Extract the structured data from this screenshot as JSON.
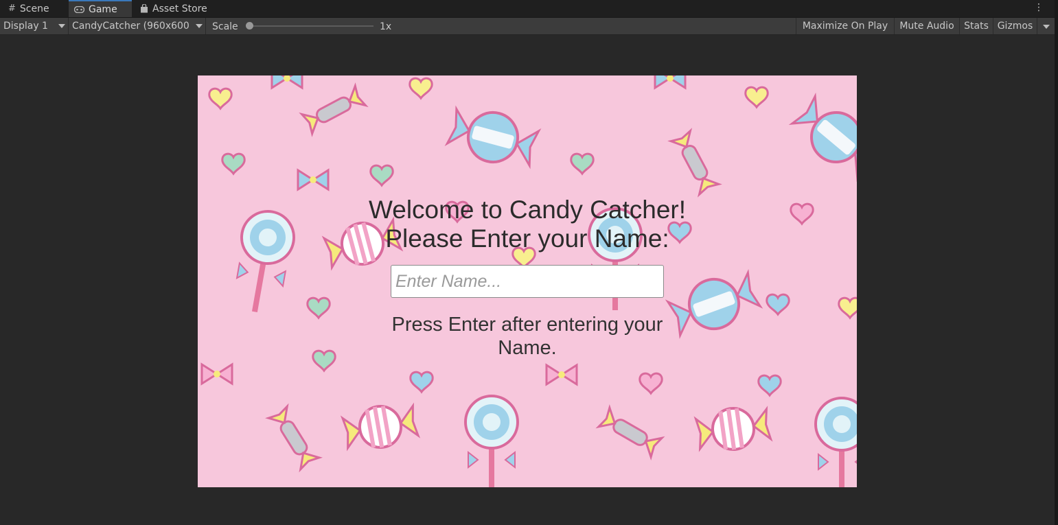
{
  "tabs": [
    {
      "label": "Scene",
      "icon": "grid-icon"
    },
    {
      "label": "Game",
      "icon": "gamepad-icon"
    },
    {
      "label": "Asset Store",
      "icon": "bag-icon"
    }
  ],
  "toolbar": {
    "display": "Display 1",
    "resolution": "CandyCatcher (960x600",
    "scale_label": "Scale",
    "scale_value": "1x",
    "maximize": "Maximize On Play",
    "mute": "Mute Audio",
    "stats": "Stats",
    "gizmos": "Gizmos"
  },
  "game": {
    "welcome_line1": "Welcome to Candy Catcher!",
    "welcome_line2": "Please Enter your Name:",
    "input_placeholder": "Enter Name...",
    "hint": "Press Enter after entering your Name."
  },
  "colors": {
    "accent": "#3a79bb",
    "game_background": "#f7c7dc"
  }
}
